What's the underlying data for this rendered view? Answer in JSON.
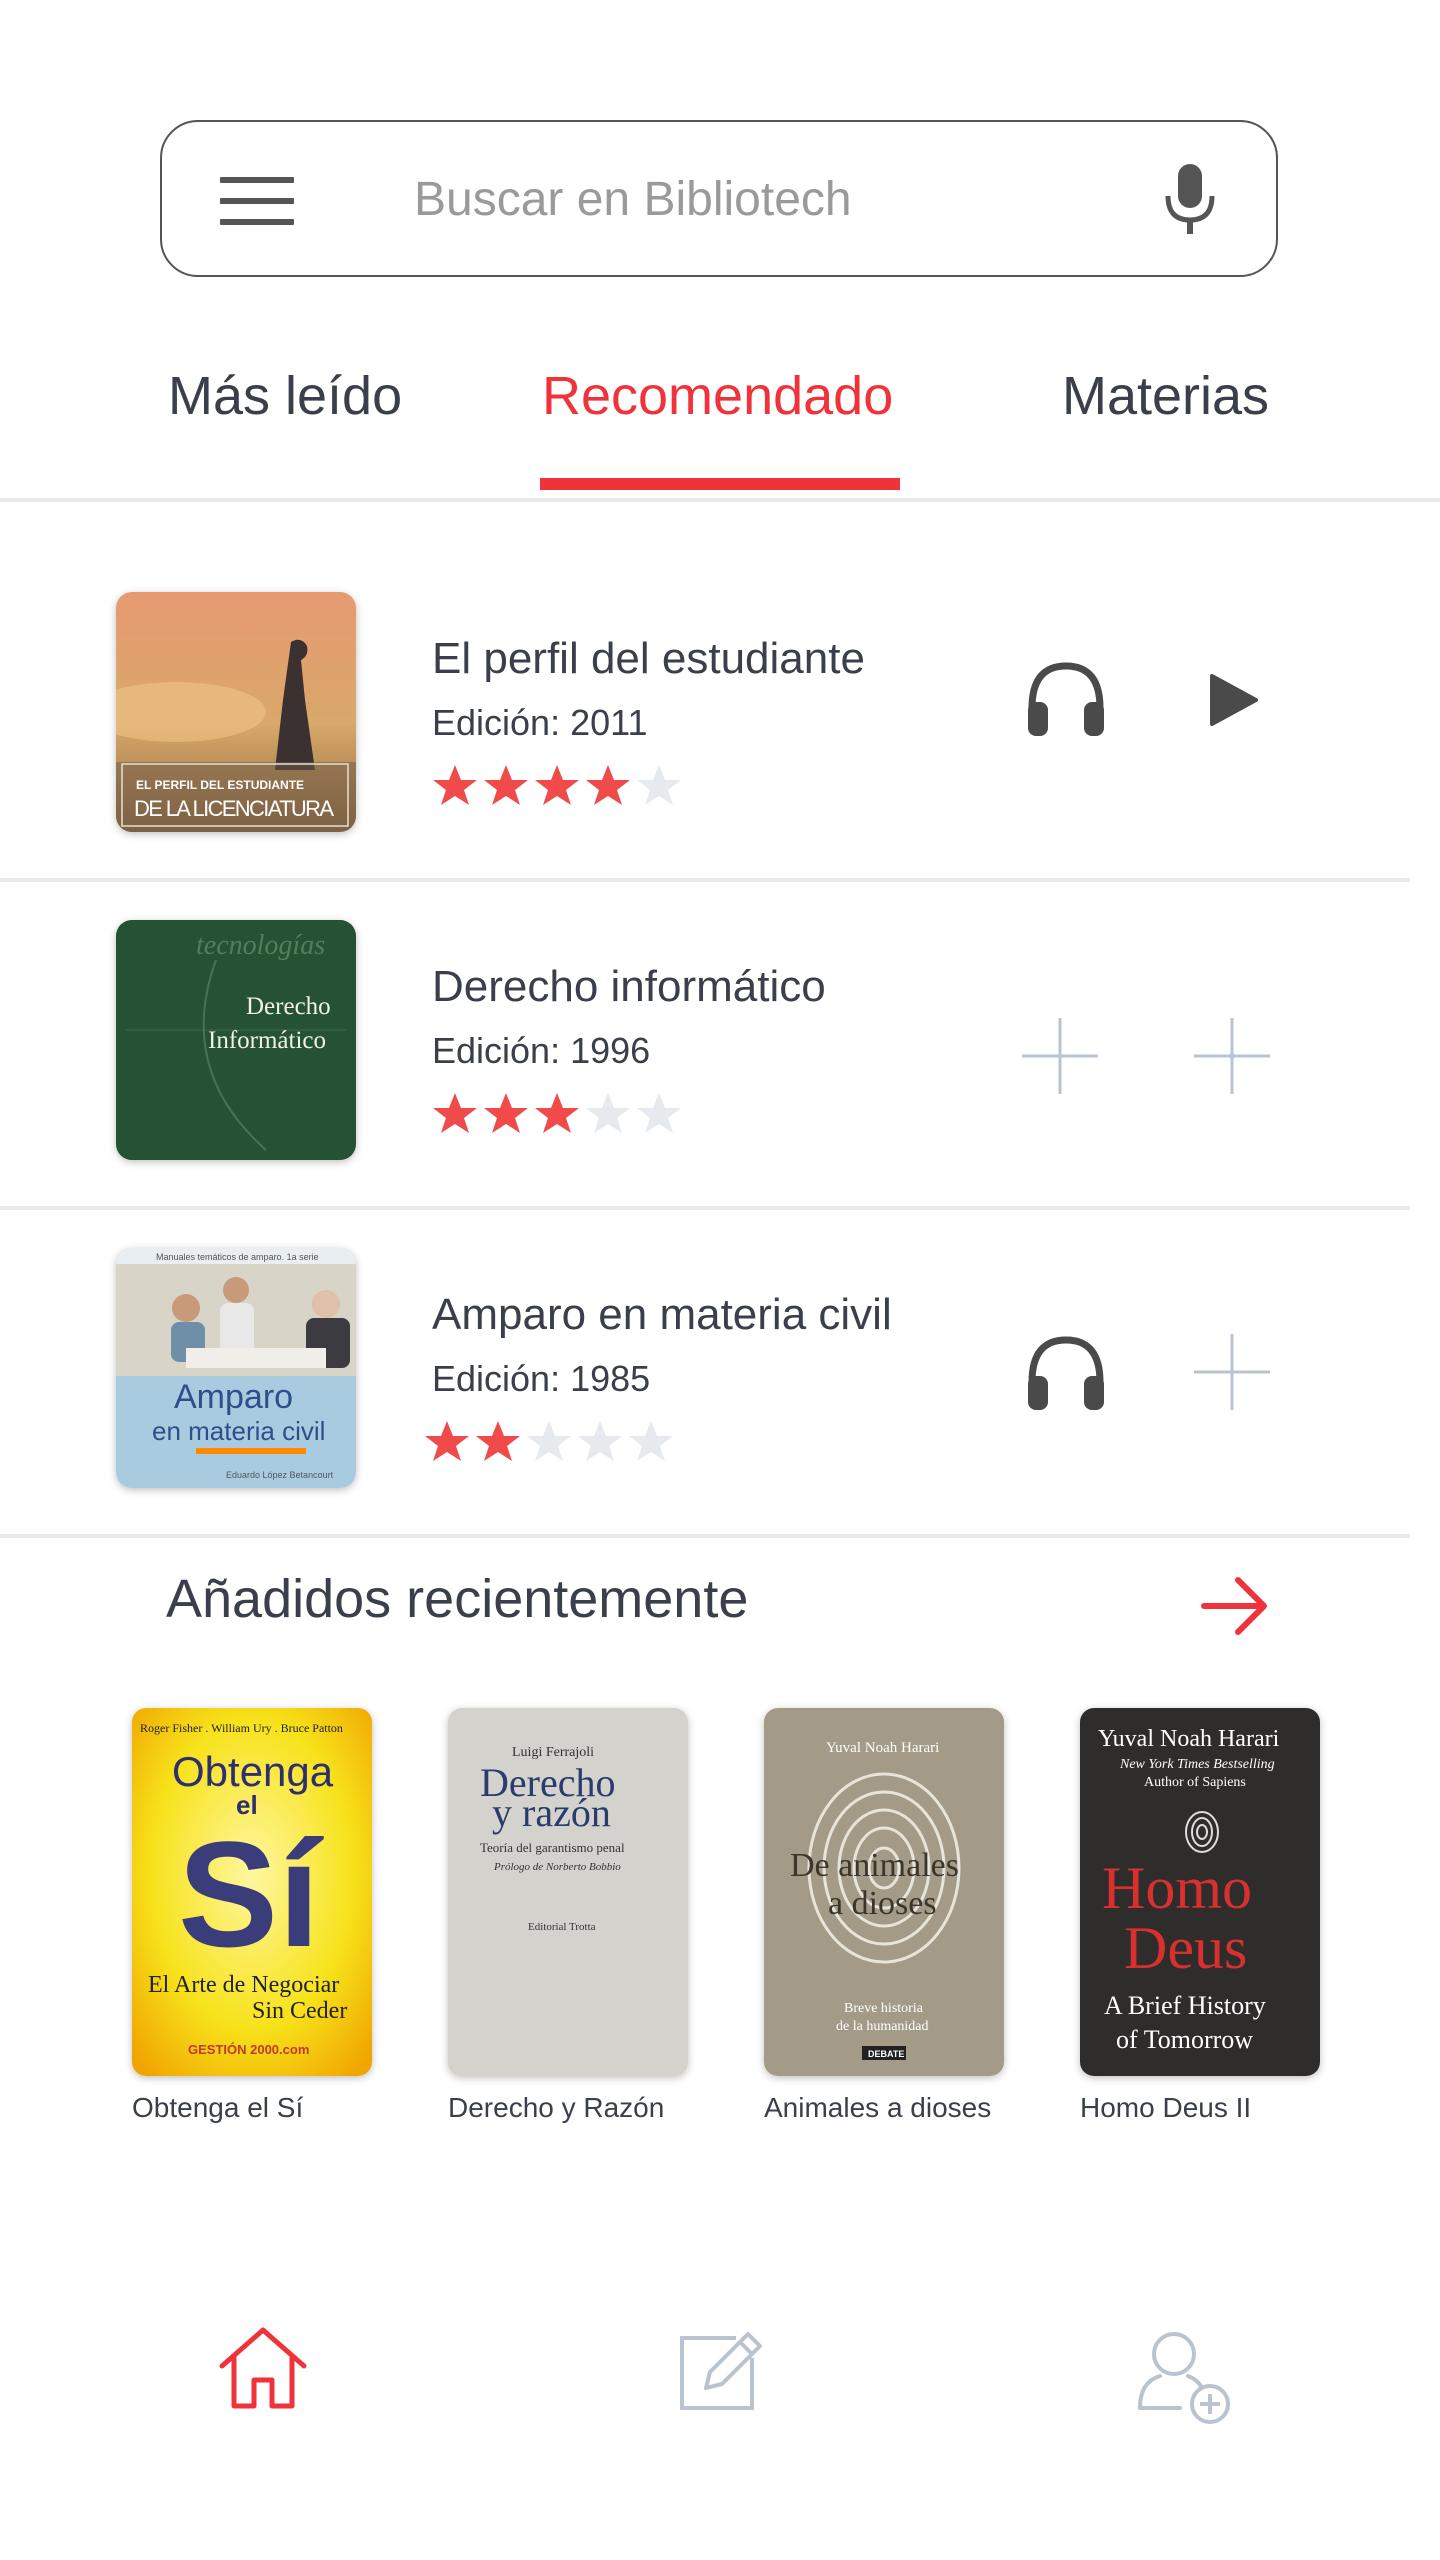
{
  "search": {
    "placeholder": "Buscar en Bibliotech"
  },
  "tabs": [
    {
      "label": "Más leído"
    },
    {
      "label": "Recomendado"
    },
    {
      "label": "Materias"
    }
  ],
  "colors": {
    "accent": "#f0323a",
    "star_on": "#f04a4a",
    "star_off": "#e6e9ee",
    "text": "#3a3f4b"
  },
  "books": [
    {
      "title": "El perfil del estudiante",
      "edition": "Edición: 2011",
      "rating": 4,
      "cover": {
        "line1": "EL PERFIL DEL ESTUDIANTE",
        "line2": "DE LA LICENCIATURA"
      },
      "actions": [
        "headphones-icon",
        "play-icon"
      ]
    },
    {
      "title": "Derecho informático",
      "edition": "Edición: 1996",
      "rating": 3,
      "cover": {
        "line1": "Derecho",
        "line2": "Informático",
        "watermark": "tecnologías"
      },
      "actions": [
        "plus-icon",
        "plus-icon"
      ]
    },
    {
      "title": "Amparo en materia civil",
      "edition": "Edición: 1985",
      "rating": 2,
      "cover": {
        "line1": "Amparo",
        "line2": "en materia civil",
        "top": "Manuales temáticos de amparo. 1a serie",
        "author": "Eduardo López Betancourt"
      },
      "actions": [
        "headphones-icon",
        "plus-icon"
      ]
    }
  ],
  "recent": {
    "title": "Añadidos recientemente",
    "items": [
      {
        "caption": "Obtenga el Sí",
        "cover": {
          "authors": "Roger Fisher . William Ury . Bruce Patton",
          "t1": "Obtenga",
          "t2": "el",
          "t3": "Sí",
          "sub1": "El Arte de Negociar",
          "sub2": "Sin Ceder",
          "brand": "GESTIÓN 2000.com"
        }
      },
      {
        "caption": "Derecho y Razón",
        "cover": {
          "author": "Luigi Ferrajoli",
          "t1": "Derecho",
          "t2": "y razón",
          "sub": "Teoría del garantismo penal",
          "prologue": "Prólogo de Norberto Bobbio",
          "publisher": "Editorial Trotta"
        }
      },
      {
        "caption": "Animales a dioses",
        "cover": {
          "author": "Yuval Noah Harari",
          "t1": "De animales",
          "t2": "a dioses",
          "sub1": "Breve historia",
          "sub2": "de la humanidad",
          "publisher": "DEBATE"
        }
      },
      {
        "caption": "Homo Deus II",
        "cover": {
          "author": "Yuval Noah Harari",
          "tag1": "New York Times Bestselling",
          "tag2": "Author of Sapiens",
          "t1": "Homo",
          "t2": "Deus",
          "sub1": "A Brief History",
          "sub2": "of Tomorrow"
        }
      }
    ]
  },
  "bottom_nav": [
    {
      "icon": "home-icon",
      "active": true
    },
    {
      "icon": "edit-icon",
      "active": false
    },
    {
      "icon": "add-user-icon",
      "active": false
    }
  ]
}
